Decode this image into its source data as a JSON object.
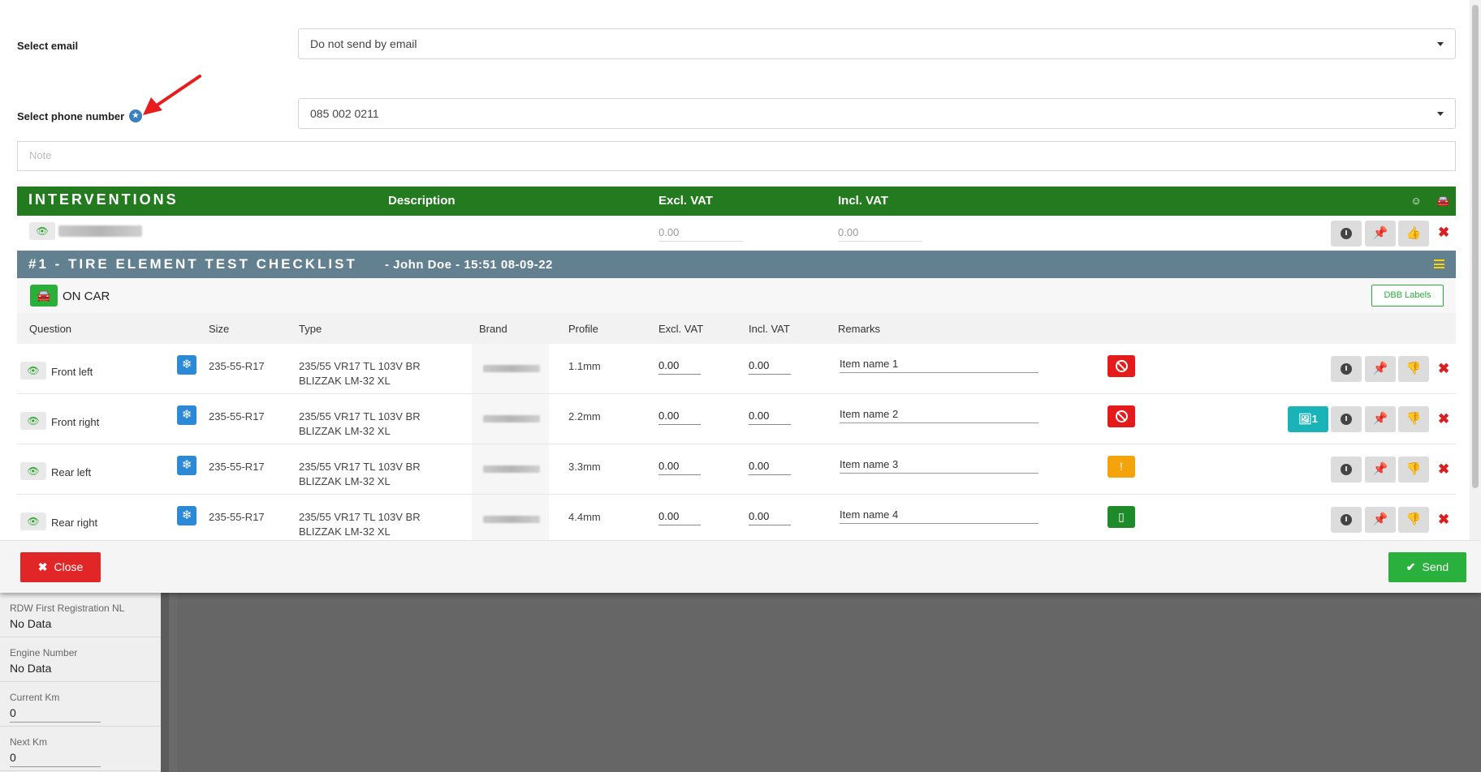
{
  "form": {
    "email_label": "Select email",
    "email_value": "Do not send by email",
    "phone_label": "Select phone number",
    "phone_value": "085 002 0211",
    "note_placeholder": "Note"
  },
  "interventions": {
    "title": "INTERVENTIONS",
    "col_description": "Description",
    "col_excl": "Excl. VAT",
    "col_incl": "Incl. VAT",
    "icons": [
      "face-icon",
      "car-icon"
    ],
    "row": {
      "excl": "0.00",
      "incl": "0.00"
    }
  },
  "checklist": {
    "title": "#1 - TIRE ELEMENT TEST CHECKLIST",
    "subtitle": "- John Doe - 15:51 08-09-22",
    "section": "ON CAR",
    "dbb_button": "DBB Labels",
    "columns": {
      "question": "Question",
      "size": "Size",
      "type": "Type",
      "brand": "Brand",
      "profile": "Profile",
      "excl": "Excl. VAT",
      "incl": "Incl. VAT",
      "remarks": "Remarks"
    },
    "rows": [
      {
        "question": "Front left",
        "size": "235-55-R17",
        "type": "235/55 VR17 TL 103V BR BLIZZAK LM-32 XL",
        "profile": "1.1mm",
        "excl": "0.00",
        "incl": "0.00",
        "remark": "Item name 1",
        "status": "red",
        "status_icon": "ban-icon"
      },
      {
        "question": "Front right",
        "size": "235-55-R17",
        "type": "235/55 VR17 TL 103V BR BLIZZAK LM-32 XL",
        "profile": "2.2mm",
        "excl": "0.00",
        "incl": "0.00",
        "remark": "Item name 2",
        "status": "red",
        "status_icon": "ban-icon",
        "photo_count": "1"
      },
      {
        "question": "Rear left",
        "size": "235-55-R17",
        "type": "235/55 VR17 TL 103V BR BLIZZAK LM-32 XL",
        "profile": "3.3mm",
        "excl": "0.00",
        "incl": "0.00",
        "remark": "Item name 3",
        "status": "orange",
        "status_icon": "warning-icon"
      },
      {
        "question": "Rear right",
        "size": "235-55-R17",
        "type": "235/55 VR17 TL 103V BR BLIZZAK LM-32 XL",
        "profile": "4.4mm",
        "excl": "0.00",
        "incl": "0.00",
        "remark": "Item name 4",
        "status": "green",
        "status_icon": "document-icon"
      }
    ]
  },
  "footer": {
    "close_label": "Close",
    "send_label": "Send"
  },
  "background": {
    "fields": [
      {
        "label": "RDW First Registration NL",
        "value": "No Data"
      },
      {
        "label": "Engine Number",
        "value": "No Data"
      },
      {
        "label": "Current Km",
        "value": "0"
      },
      {
        "label": "Next Km",
        "value": "0"
      }
    ]
  },
  "colors": {
    "interventions_header": "#237a1f",
    "checklist_header": "#62808f",
    "close_button": "#e02626",
    "send_button": "#29b03d",
    "status_red": "#e31b1b",
    "status_orange": "#f5a30a",
    "status_green": "#1f8a2a",
    "snow_badge": "#2b89d6",
    "photo_badge": "#1ab3b8",
    "annotation_arrow": "#e81c1c"
  }
}
